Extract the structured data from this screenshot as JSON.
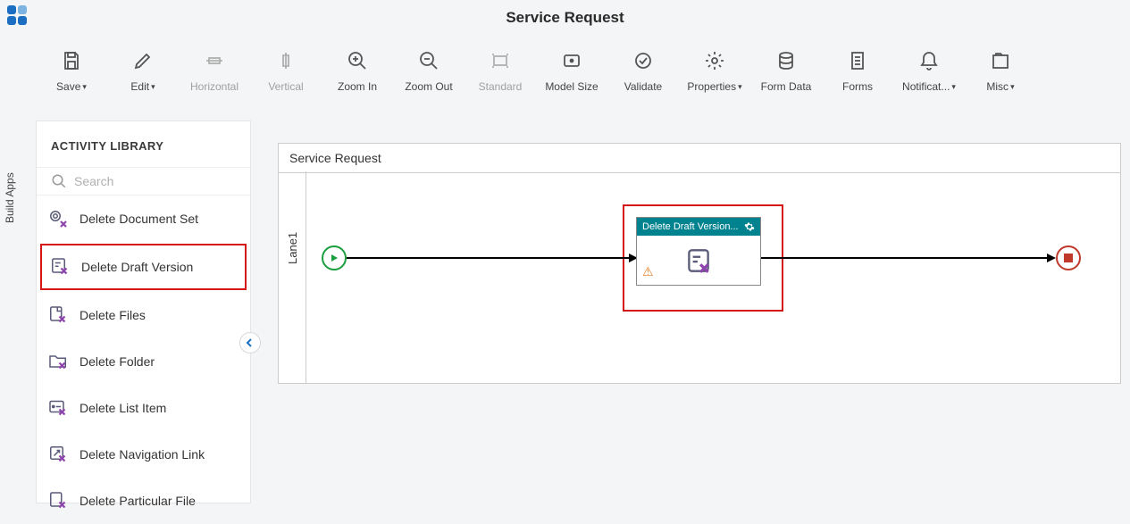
{
  "side_tab": "Build Apps",
  "page_title": "Service Request",
  "toolbar": [
    {
      "label": "Save",
      "chev": true,
      "disabled": false
    },
    {
      "label": "Edit",
      "chev": true,
      "disabled": false
    },
    {
      "label": "Horizontal",
      "chev": false,
      "disabled": true
    },
    {
      "label": "Vertical",
      "chev": false,
      "disabled": true
    },
    {
      "label": "Zoom In",
      "chev": false,
      "disabled": false
    },
    {
      "label": "Zoom Out",
      "chev": false,
      "disabled": false
    },
    {
      "label": "Standard",
      "chev": false,
      "disabled": true
    },
    {
      "label": "Model Size",
      "chev": false,
      "disabled": false
    },
    {
      "label": "Validate",
      "chev": false,
      "disabled": false
    },
    {
      "label": "Properties",
      "chev": true,
      "disabled": false
    },
    {
      "label": "Form Data",
      "chev": false,
      "disabled": false
    },
    {
      "label": "Forms",
      "chev": false,
      "disabled": false
    },
    {
      "label": "Notificat...",
      "chev": true,
      "disabled": false
    },
    {
      "label": "Misc",
      "chev": true,
      "disabled": false
    }
  ],
  "sidebar": {
    "title": "ACTIVITY LIBRARY",
    "search_placeholder": "Search",
    "items": [
      "Delete Document Set",
      "Delete Draft Version",
      "Delete Files",
      "Delete Folder",
      "Delete List Item",
      "Delete Navigation Link",
      "Delete Particular File"
    ]
  },
  "canvas": {
    "title": "Service Request",
    "lane": "Lane1",
    "activity_label": "Delete Draft Version..."
  }
}
